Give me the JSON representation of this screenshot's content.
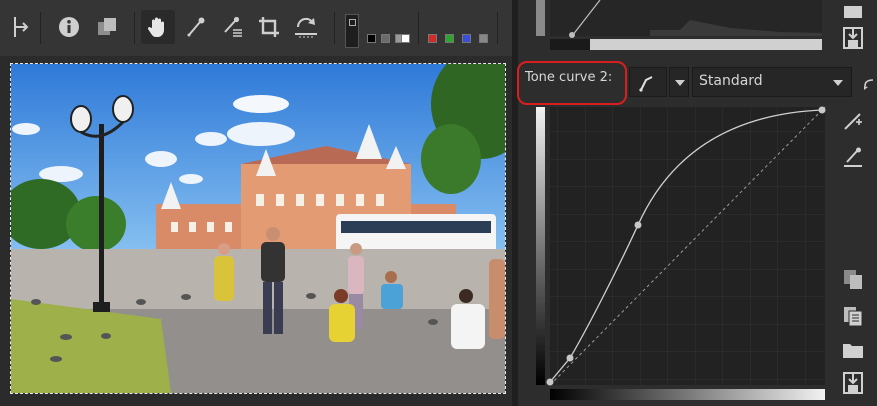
{
  "toolbar": {
    "tools": [
      {
        "name": "split-before-after-icon"
      },
      {
        "name": "info-icon"
      },
      {
        "name": "compare-icon"
      },
      {
        "name": "hand-icon"
      },
      {
        "name": "color-picker-icon"
      },
      {
        "name": "white-balance-picker-icon"
      },
      {
        "name": "crop-icon"
      },
      {
        "name": "straighten-icon"
      }
    ],
    "colors": {
      "preview_swatches": [
        "#000000",
        "#6b6b6b",
        "#9a9a9a",
        "#ffffff"
      ],
      "channel_swatches": [
        "#d22a2a",
        "#2fa52f",
        "#3a4fd8",
        "#888888"
      ]
    }
  },
  "curve_panel": {
    "label": "Tone curve 2:",
    "curve_type": "Standard",
    "colors": {
      "highlight": "#d81f1f",
      "curve": "#cfcfcf"
    }
  },
  "side_icons": [
    "save-icon",
    "save-icon",
    "edit-points-icon",
    "pipette-line-icon",
    "copy-icon",
    "paste-icon",
    "open-folder-icon",
    "save-icon",
    "reset-icon"
  ]
}
